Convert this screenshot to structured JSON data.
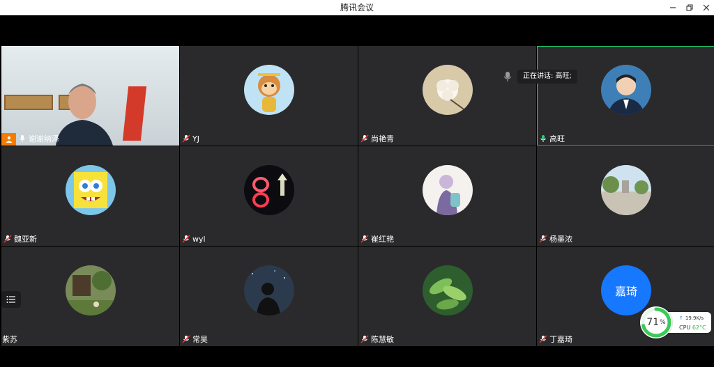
{
  "window": {
    "title": "腾讯会议"
  },
  "speaking_indicator": {
    "text": "正在讲话: 高旺;"
  },
  "participants": [
    {
      "name": "谢谢纳泽",
      "type": "video",
      "mic": "on",
      "host": true
    },
    {
      "name": "YJ",
      "type": "avatar",
      "avatar_icon": "monkey-avatar",
      "mic": "muted"
    },
    {
      "name": "尚艳青",
      "type": "avatar",
      "avatar_icon": "flower-avatar",
      "mic": "muted"
    },
    {
      "name": "高旺",
      "type": "avatar",
      "avatar_icon": "man-avatar",
      "mic": "on",
      "speaking": true
    },
    {
      "name": "魏亚新",
      "type": "avatar",
      "avatar_icon": "spongebob-avatar",
      "mic": "muted"
    },
    {
      "name": "wyl",
      "type": "avatar",
      "avatar_icon": "night-lights-avatar",
      "mic": "muted"
    },
    {
      "name": "崔红艳",
      "type": "avatar",
      "avatar_icon": "anime-girl-avatar",
      "mic": "muted"
    },
    {
      "name": "杨墨浓",
      "type": "avatar",
      "avatar_icon": "park-avatar",
      "mic": "muted"
    },
    {
      "name": "紫苏",
      "type": "avatar",
      "avatar_icon": "garden-avatar",
      "mic": "none"
    },
    {
      "name": "常昊",
      "type": "avatar",
      "avatar_icon": "night-sky-avatar",
      "mic": "muted"
    },
    {
      "name": "陈慧敏",
      "type": "avatar",
      "avatar_icon": "leaves-avatar",
      "mic": "muted"
    },
    {
      "name": "丁嘉琦",
      "type": "text-avatar",
      "avatar_text": "嘉琦",
      "mic": "muted"
    }
  ],
  "perf": {
    "percent": "71",
    "percent_unit": "%",
    "net_speed": "19.9K/s",
    "cpu_label": "CPU",
    "cpu_temp": "62°C"
  },
  "colors": {
    "speaking_border": "#1bd36a",
    "tile_bg": "#2a2a2c",
    "accent": "#1677ff",
    "host_badge": "#f57c00"
  }
}
